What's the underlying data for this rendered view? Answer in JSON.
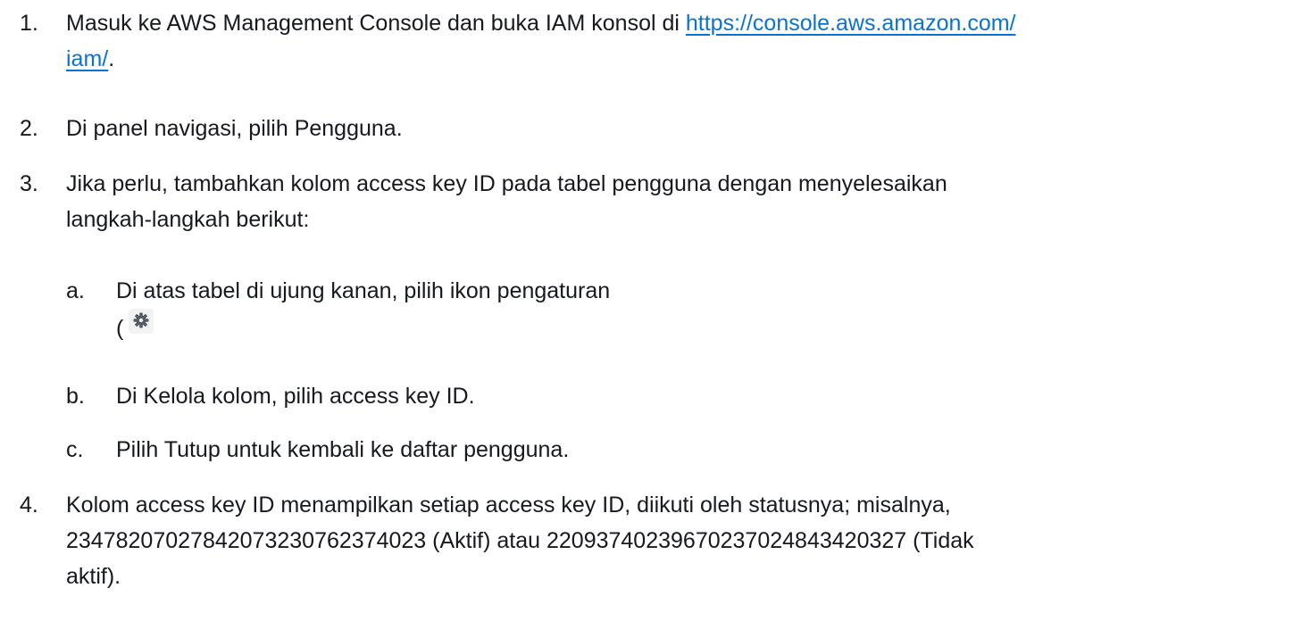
{
  "steps": {
    "s1": {
      "number": "1.",
      "text_before": "Masuk ke AWS Management Console dan buka IAM konsol di ",
      "link_line1": "https://console.aws.amazon.com/",
      "link_line2": "iam/",
      "text_after": "."
    },
    "s2": {
      "number": "2.",
      "text": "Di panel navigasi, pilih Pengguna."
    },
    "s3": {
      "number": "3.",
      "line1": "Jika perlu, tambahkan kolom access key ID pada tabel pengguna dengan menyelesaikan",
      "line2": "langkah-langkah berikut:",
      "substeps": {
        "a": {
          "label": "a.",
          "text": "Di atas tabel di ujung kanan, pilih ikon pengaturan",
          "paren": "(",
          "icon": "gear-icon"
        },
        "b": {
          "label": "b.",
          "text": "Di Kelola kolom, pilih access key ID."
        },
        "c": {
          "label": "c.",
          "text": "Pilih Tutup untuk kembali ke daftar pengguna."
        }
      }
    },
    "s4": {
      "number": "4.",
      "line1": "Kolom access key ID menampilkan setiap access key ID, diikuti oleh statusnya; misalnya,",
      "line2": "23478207027842073230762374023 (Aktif) atau 22093740239670237024843420327 (Tidak",
      "line3": "aktif)."
    }
  },
  "colors": {
    "text": "#16191f",
    "link": "#0972d3",
    "icon": "#545b64"
  }
}
